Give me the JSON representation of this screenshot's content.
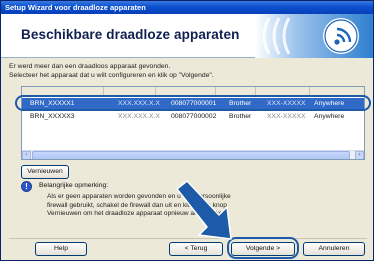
{
  "window": {
    "title": "Setup Wizard voor draadloze apparaten"
  },
  "header": {
    "title": "Beschikbare draadloze apparaten"
  },
  "intro": {
    "line1": "Er werd meer dan een draadloos apparaat gevonden.",
    "line2": "Selecteer het apparaat dat u wilt configureren en klik op \"Volgende\"."
  },
  "device_list": {
    "rows": [
      {
        "name": "BRN_XXXXX1",
        "ip": "XXX.XXX.X.X",
        "serial": "008077000001",
        "vendor": "Brother",
        "model": "XXX-XXXXX",
        "location": "Anywhere",
        "selected": true
      },
      {
        "name": "BRN_XXXXX3",
        "ip": "XXX.XXX.X.X",
        "serial": "008077000002",
        "vendor": "Brother",
        "model": "XXX-XXXXX",
        "location": "Anywhere",
        "selected": false
      }
    ]
  },
  "buttons": {
    "refresh": "Vernieuwen",
    "help": "Help",
    "back": "< Terug",
    "next": "Volgende >",
    "cancel": "Annuleren"
  },
  "note": {
    "heading": "Belangrijke opmerking:",
    "line1": "Als er geen apparaten worden gevonden en u een persoonlijke",
    "line2": "firewall gebruikt, schakel de firewall dan uit en klik op de knop",
    "line3": "Vernieuwen om het draadloze apparaat opnieuw af te zoeken."
  },
  "colors": {
    "accent": "#1d5aa8",
    "selection": "#3169c6",
    "titlebar": "#0a4fd0"
  }
}
